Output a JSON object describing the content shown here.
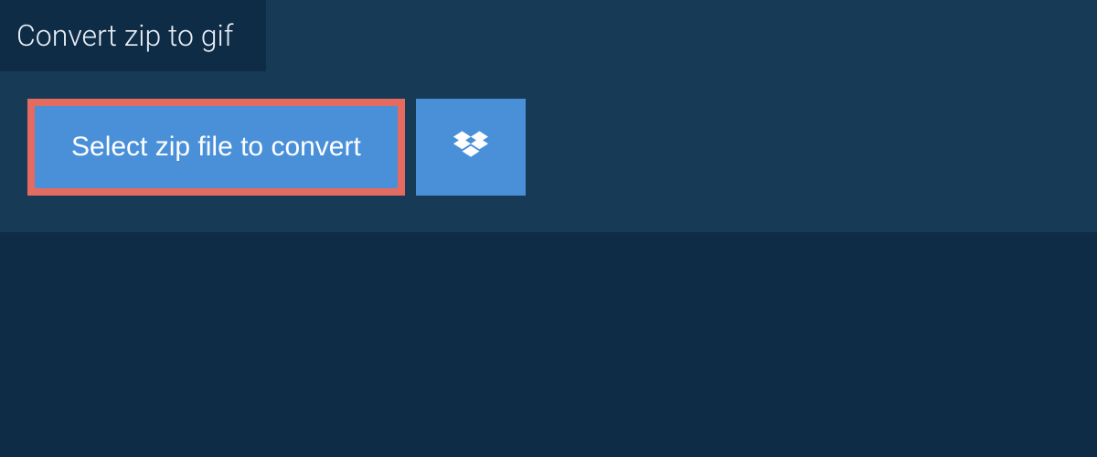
{
  "tab": {
    "title": "Convert zip to gif"
  },
  "actions": {
    "select_file_label": "Select zip file to convert"
  },
  "colors": {
    "page_bg": "#0f2c47",
    "panel_bg": "#173a56",
    "button_bg": "#4a90d9",
    "highlight_border": "#e56a5f",
    "text_light": "#e8eef4",
    "text_button": "#ffffff"
  }
}
